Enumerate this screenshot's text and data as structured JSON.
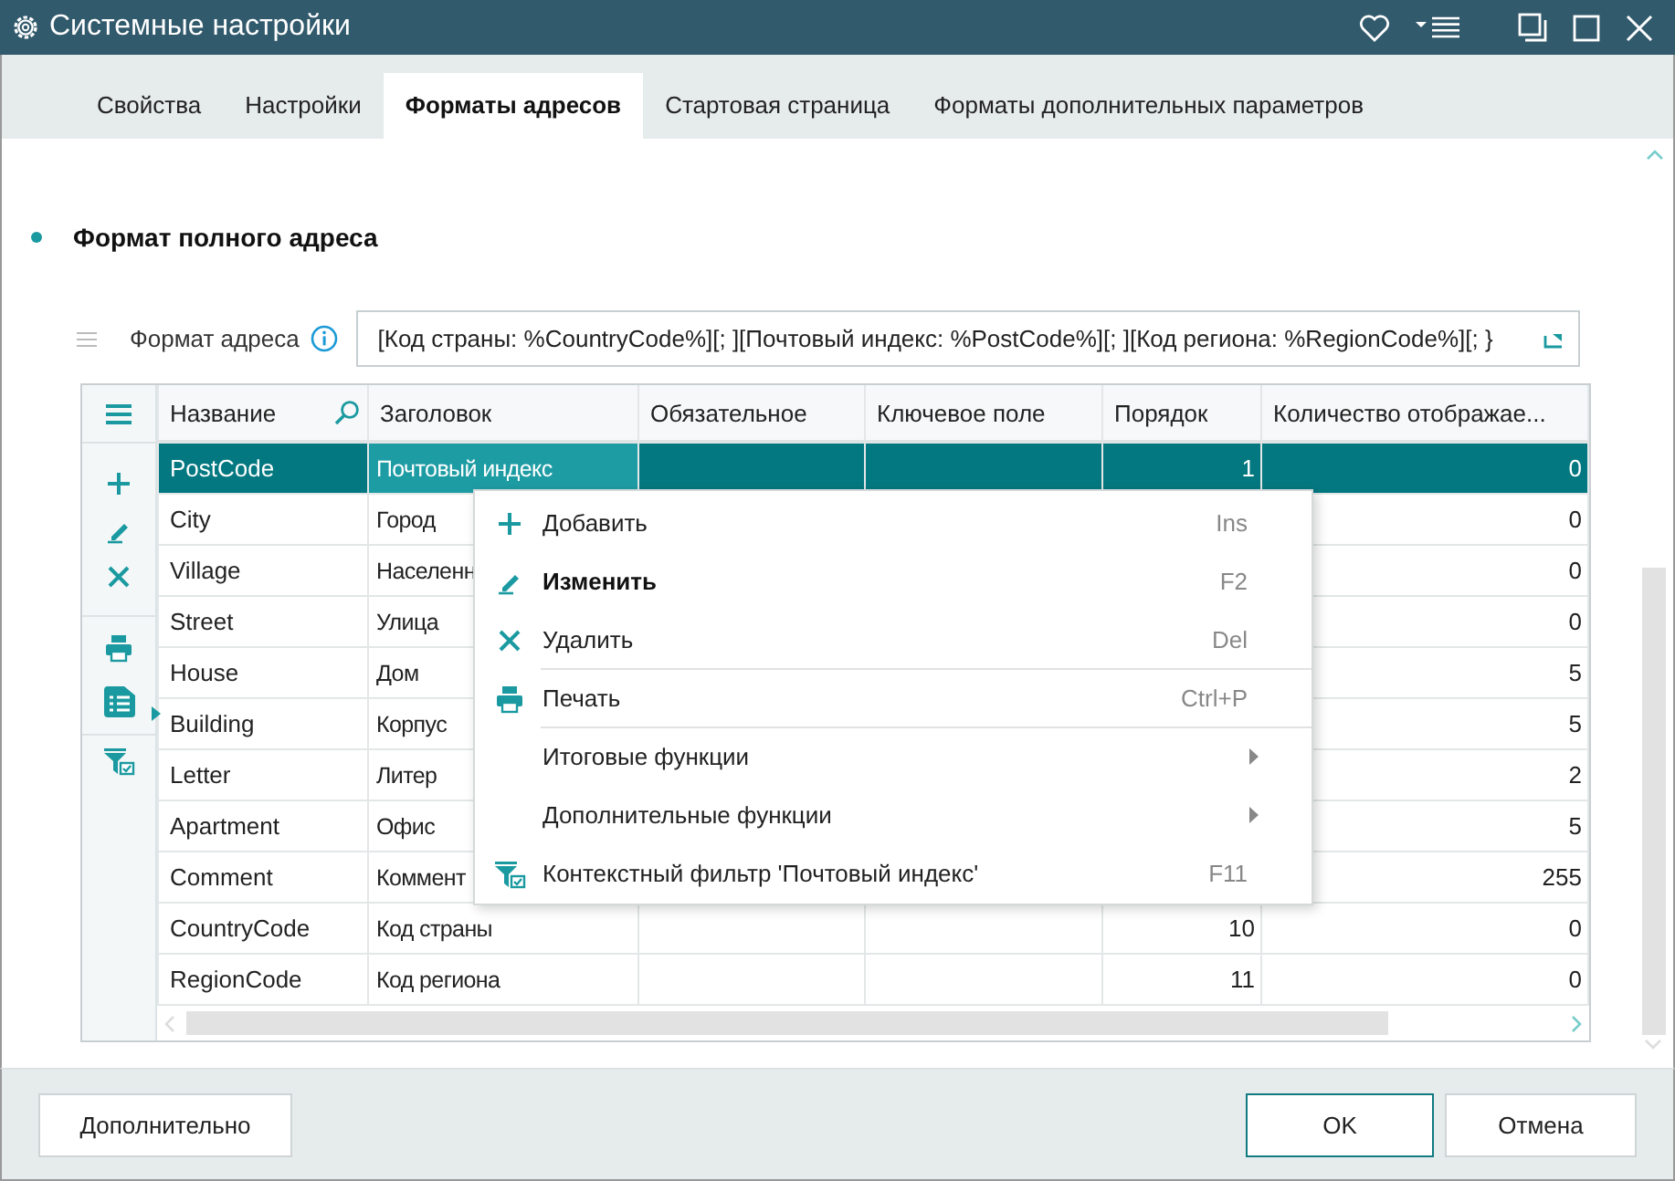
{
  "window": {
    "title": "Системные настройки"
  },
  "tabs": [
    {
      "label": "Свойства",
      "selected": false
    },
    {
      "label": "Настройки",
      "selected": false
    },
    {
      "label": "Форматы адресов",
      "selected": true
    },
    {
      "label": "Стартовая страница",
      "selected": false
    },
    {
      "label": "Форматы дополнительных параметров",
      "selected": false
    }
  ],
  "section": {
    "title": "Формат полного адреса"
  },
  "format_field": {
    "label": "Формат адреса",
    "value": "[Код страны: %CountryCode%][; ][Почтовый индекс: %PostCode%][; ][Код региона: %RegionCode%][; }"
  },
  "table": {
    "columns": [
      "Название",
      "Заголовок",
      "Обязательное",
      "Ключевое поле",
      "Порядок",
      "Количество отображае..."
    ],
    "rows": [
      {
        "name": "PostCode",
        "title": "Почтовый индекс",
        "order": "1",
        "count": "0",
        "selected": true
      },
      {
        "name": "City",
        "title": "Город",
        "count": "0",
        "selected": false
      },
      {
        "name": "Village",
        "title": "Населенн",
        "count": "0",
        "selected": false
      },
      {
        "name": "Street",
        "title": "Улица",
        "count": "0",
        "selected": false
      },
      {
        "name": "House",
        "title": "Дом",
        "count": "5",
        "selected": false
      },
      {
        "name": "Building",
        "title": "Корпус",
        "count": "5",
        "selected": false
      },
      {
        "name": "Letter",
        "title": "Литер",
        "count": "2",
        "selected": false
      },
      {
        "name": "Apartment",
        "title": "Офис",
        "count": "5",
        "selected": false
      },
      {
        "name": "Comment",
        "title": "Коммент",
        "count": "255",
        "selected": false
      },
      {
        "name": "CountryCode",
        "title": "Код страны",
        "order": "10",
        "count": "0",
        "selected": false
      },
      {
        "name": "RegionCode",
        "title": "Код региона",
        "order": "11",
        "count": "0",
        "selected": false
      }
    ]
  },
  "context_menu": {
    "items": [
      {
        "label": "Добавить",
        "shortcut": "Ins",
        "default": false,
        "submenu": false,
        "separator_before": false
      },
      {
        "label": "Изменить",
        "shortcut": "F2",
        "default": true,
        "submenu": false,
        "separator_before": false
      },
      {
        "label": "Удалить",
        "shortcut": "Del",
        "default": false,
        "submenu": false,
        "separator_before": false
      },
      {
        "label": "Печать",
        "shortcut": "Ctrl+P",
        "default": false,
        "submenu": false,
        "separator_before": true
      },
      {
        "label": "Итоговые функции",
        "default": false,
        "submenu": true,
        "separator_before": true
      },
      {
        "label": "Дополнительные функции",
        "default": false,
        "submenu": true,
        "separator_before": false
      },
      {
        "label": "Контекстный фильтр 'Почтовый индекс'",
        "shortcut": "F11",
        "default": false,
        "submenu": false,
        "separator_before": false
      }
    ]
  },
  "footer": {
    "buttons": [
      {
        "label": "Дополнительно",
        "primary": false
      },
      {
        "label": "OK",
        "primary": true
      },
      {
        "label": "Отмена",
        "primary": false
      }
    ]
  }
}
